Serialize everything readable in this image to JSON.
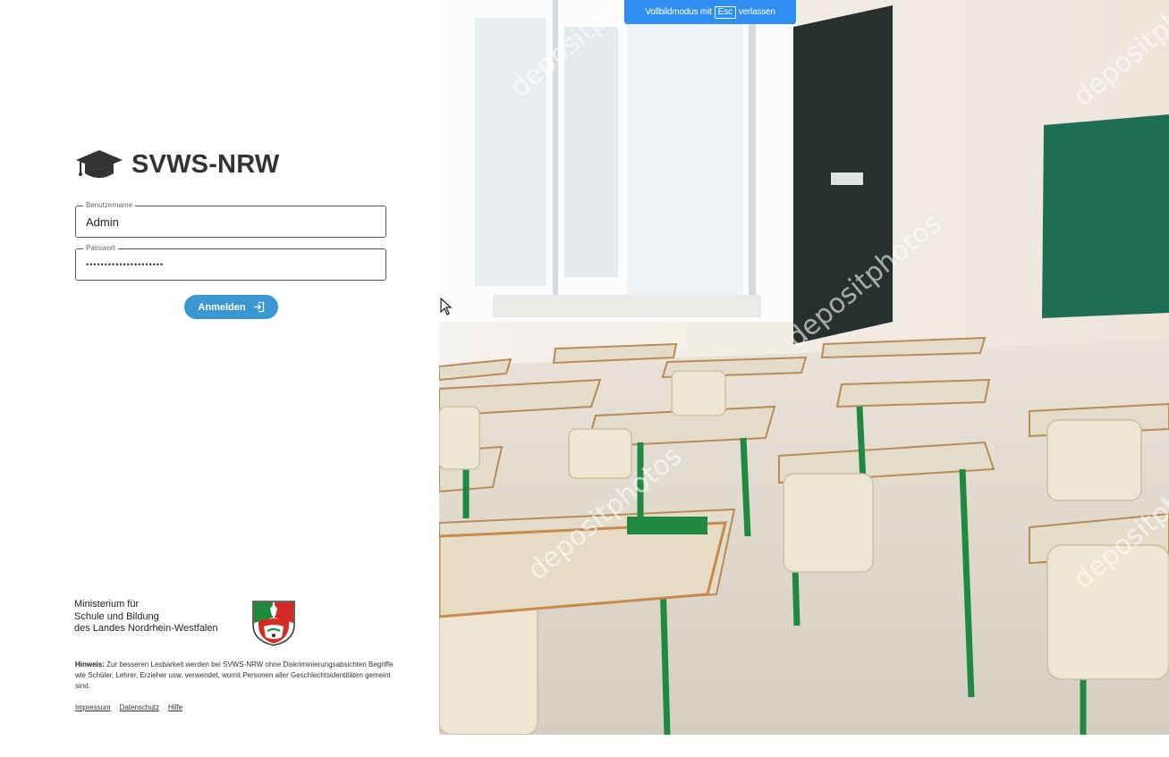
{
  "app": {
    "title": "SVWS-NRW",
    "logo_icon": "graduation-cap-icon"
  },
  "login": {
    "username": {
      "label": "Benutzername",
      "value": "Admin"
    },
    "password": {
      "label": "Passwort",
      "masked_value": "•••••••••••••••••••••"
    },
    "submit_label": "Anmelden",
    "submit_icon": "login-arrow-icon",
    "button_color": "#3a97d4"
  },
  "ministry": {
    "line1": "Ministerium für",
    "line2": "Schule und Bildung",
    "line3": "des Landes Nordrhein-Westfalen",
    "crest_icon": "nrw-coat-of-arms-icon"
  },
  "notice": {
    "label": "Hinweis:",
    "text": "Zur besseren Lesbarkeit werden bei SVWS-NRW ohne Diskriminierungsabsichten Begriffe wie Schüler, Lehrer, Erzieher usw. verwendet, womit Personen aller Geschlechtsidentitäten gemeint sind."
  },
  "footer": {
    "links": [
      "Impressum",
      "Datenschutz",
      "Hilfe"
    ]
  },
  "fullscreen_banner": {
    "before": "Vollbildmodus mit",
    "key": "Esc",
    "after": "verlassen",
    "color": "#2f8ff0"
  },
  "background_image": {
    "subject": "classroom-photo",
    "watermark": "depositphotos"
  }
}
